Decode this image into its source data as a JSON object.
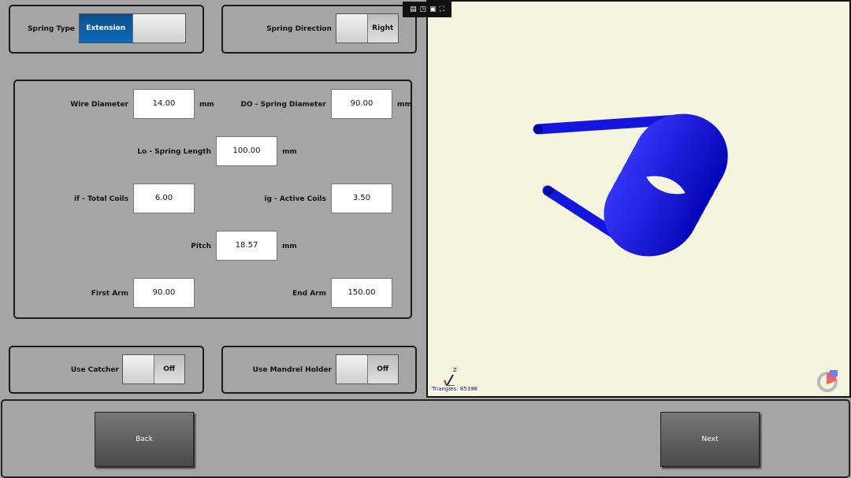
{
  "spring_type": {
    "label": "Spring Type",
    "selected": "Extension"
  },
  "spring_direction": {
    "label": "Spring Direction",
    "selected": "Right"
  },
  "fields": [
    {
      "label": "Wire Diameter",
      "value": "14.00",
      "unit": "mm"
    },
    {
      "label": "DO - Spring Diameter",
      "value": "90.00",
      "unit": "mm"
    },
    {
      "label": "Lo - Spring Length",
      "value": "100.00",
      "unit": "mm"
    },
    {
      "label": "if - Total Coils",
      "value": "6.00",
      "unit": ""
    },
    {
      "label": "ig - Active Coils",
      "value": "3.50",
      "unit": ""
    },
    {
      "label": "Pitch",
      "value": "18.57",
      "unit": "mm"
    },
    {
      "label": "First Arm",
      "value": "90.00",
      "unit": ""
    },
    {
      "label": "End Arm",
      "value": "150.00",
      "unit": ""
    }
  ],
  "use_catcher": {
    "label": "Use Catcher",
    "state": "Off"
  },
  "use_mandrel": {
    "label": "Use Mandrel Holder",
    "state": "Off"
  },
  "viewer": {
    "triangles": "Triangles: 85398",
    "axis_z": "Z",
    "bg": "#f4f4df",
    "spring_color": "#1010e0"
  },
  "nav": {
    "back": "Back",
    "next": "Next"
  }
}
